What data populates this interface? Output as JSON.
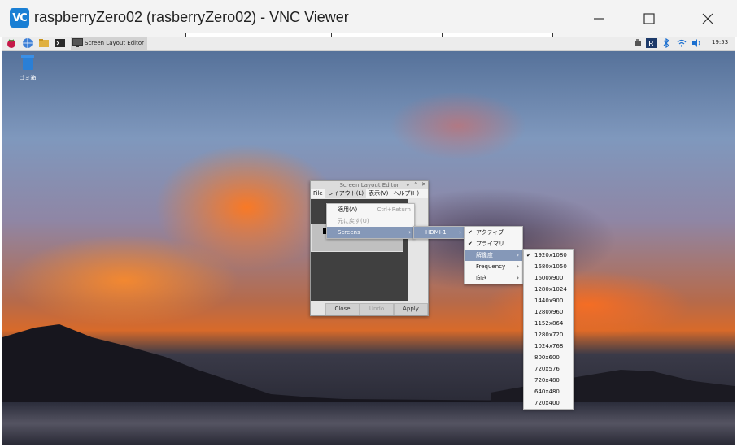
{
  "window": {
    "title": "raspberryZero02 (rasberryZero02) - VNC Viewer",
    "logo_text": "VC",
    "minimize": "—",
    "maximize": "☐",
    "close": "✕"
  },
  "taskbar": {
    "icons": [
      "raspberry-icon",
      "browser-icon",
      "files-icon",
      "terminal-icon"
    ],
    "task_label": "Screen Layout Editor",
    "tray": [
      "network-share-icon",
      "realvnc-icon",
      "bluetooth-icon",
      "wifi-icon",
      "volume-icon"
    ],
    "clock": "19:53"
  },
  "desktop": {
    "trash_label": "ゴミ箱"
  },
  "sle": {
    "title": "Screen Layout Editor",
    "controls": [
      "⌄",
      "⌃",
      "✕"
    ],
    "menus": [
      "File",
      "レイアウト(L)",
      "表示(V)",
      "ヘルプ(H)"
    ],
    "buttons": {
      "close": "Close",
      "undo": "Undo",
      "apply": "Apply"
    }
  },
  "layout_menu": [
    {
      "label": "適用(A)",
      "accel": "Ctrl+Return",
      "disabled": false
    },
    {
      "label": "元に戻す(U)",
      "accel": "",
      "disabled": true
    },
    {
      "label": "Screens",
      "accel": "",
      "disabled": false,
      "submenu": true
    }
  ],
  "screens_menu": [
    {
      "label": "HDMI-1",
      "submenu": true
    }
  ],
  "hdmi_menu": [
    {
      "label": "アクティブ",
      "checked": true,
      "submenu": false
    },
    {
      "label": "プライマリ",
      "checked": true,
      "submenu": false
    },
    {
      "label": "解像度",
      "checked": false,
      "submenu": true
    },
    {
      "label": "Frequency",
      "checked": false,
      "submenu": true
    },
    {
      "label": "向き",
      "checked": false,
      "submenu": true
    }
  ],
  "resolution_menu": {
    "selected": "1920x1080",
    "items": [
      "1920x1080",
      "1680x1050",
      "1600x900",
      "1280x1024",
      "1440x900",
      "1280x960",
      "1152x864",
      "1280x720",
      "1024x768",
      "800x600",
      "720x576",
      "720x480",
      "640x480",
      "720x400"
    ]
  },
  "colors": {
    "highlight": "#8598b8",
    "vnc_accent": "#1a7fd4"
  }
}
